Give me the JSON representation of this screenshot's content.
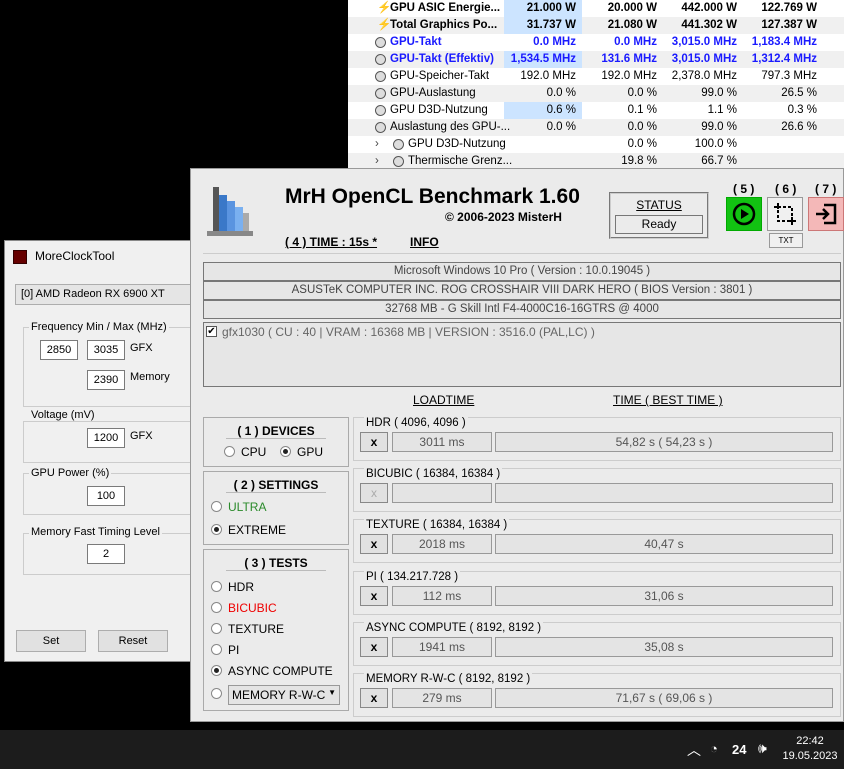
{
  "sensors": [
    {
      "name": "GPU ASIC Energie...",
      "icon": "bolt-icon",
      "style": "b",
      "values": [
        "21.000 W",
        "20.000 W",
        "442.000 W",
        "122.769 W"
      ],
      "hl": true
    },
    {
      "name": "Total Graphics Po...",
      "icon": "bolt-icon",
      "style": "b",
      "values": [
        "31.737 W",
        "21.080 W",
        "441.302 W",
        "127.387 W"
      ],
      "hl": true
    },
    {
      "name": "GPU-Takt",
      "icon": "clock-icon",
      "style": "blue",
      "values": [
        "0.0 MHz",
        "0.0 MHz",
        "3,015.0 MHz",
        "1,183.4 MHz"
      ]
    },
    {
      "name": "GPU-Takt (Effektiv)",
      "icon": "clock-icon",
      "style": "blue",
      "values": [
        "1,534.5 MHz",
        "131.6 MHz",
        "3,015.0 MHz",
        "1,312.4 MHz"
      ],
      "hl": true
    },
    {
      "name": "GPU-Speicher-Takt",
      "icon": "clock-icon",
      "style": "",
      "values": [
        "192.0 MHz",
        "192.0 MHz",
        "2,378.0 MHz",
        "797.3 MHz"
      ]
    },
    {
      "name": "GPU-Auslastung",
      "icon": "clock-icon",
      "style": "",
      "values": [
        "0.0 %",
        "0.0 %",
        "99.0 %",
        "26.5 %"
      ]
    },
    {
      "name": "GPU D3D-Nutzung",
      "icon": "clock-icon",
      "style": "",
      "values": [
        "0.6 %",
        "0.1 %",
        "1.1 %",
        "0.3 %"
      ],
      "hl": true
    },
    {
      "name": "Auslastung des GPU-...",
      "icon": "clock-icon",
      "style": "",
      "values": [
        "0.0 %",
        "0.0 %",
        "99.0 %",
        "26.6 %"
      ]
    },
    {
      "name": "GPU D3D-Nutzung",
      "icon": "clock-icon",
      "style": "",
      "sub": true,
      "values": [
        "",
        "0.0 %",
        "100.0 %",
        ""
      ]
    },
    {
      "name": "Thermische Grenz...",
      "icon": "clock-icon",
      "style": "",
      "sub": true,
      "values": [
        "",
        "19.8 %",
        "66.7 %",
        ""
      ]
    }
  ],
  "moreclock": {
    "title": "MoreClockTool",
    "device": "[0] AMD Radeon RX 6900 XT",
    "freq_label": "Frequency Min / Max (MHz)",
    "freq_min": "2850",
    "freq_max": "3035",
    "gfx": "GFX",
    "memory_value": "2390",
    "memory": "Memory",
    "voltage_label": "Voltage (mV)",
    "voltage": "1200",
    "power_label": "GPU Power (%)",
    "power": "100",
    "mft_label": "Memory Fast Timing Level",
    "mft": "2",
    "set": "Set",
    "reset": "Reset"
  },
  "bench": {
    "title": "MrH OpenCL Benchmark 1.60",
    "copyright": "© 2006-2023 MisterH",
    "time": "( 4 ) TIME : 15s *",
    "info": "INFO",
    "status_label": "STATUS",
    "status": "Ready",
    "b5": "( 5 )",
    "b6": "( 6 )",
    "b7": "( 7 )",
    "txt": "TXT",
    "os": "Microsoft Windows 10 Pro ( Version : 10.0.19045 )",
    "board": "ASUSTeK COMPUTER INC. ROG CROSSHAIR VIII DARK HERO ( BIOS Version : 3801 )",
    "ram": "32768 MB - G Skill Intl F4-4000C16-16GTRS @ 4000",
    "device": "gfx1030 ( CU : 40 | VRAM : 16368 MB | VERSION : 3516.0 (PAL,LC) )",
    "loadtime": "LOADTIME",
    "time_header": "TIME ( BEST TIME )",
    "devices": {
      "title": "( 1 ) DEVICES",
      "cpu": "CPU",
      "gpu": "GPU",
      "selected": "GPU"
    },
    "settings": {
      "title": "( 2 ) SETTINGS",
      "ultra": "ULTRA",
      "extreme": "EXTREME",
      "selected": "EXTREME"
    },
    "tests_title": "( 3 ) TESTS",
    "test_options": [
      "HDR",
      "BICUBIC",
      "TEXTURE",
      "PI",
      "ASYNC COMPUTE",
      "MEMORY R-W-C"
    ],
    "selected_test": "ASYNC COMPUTE",
    "tests": [
      {
        "title": "HDR ( 4096, 4096 )",
        "x": "x",
        "load": "3011 ms",
        "time": "54,82 s ( 54,23 s )"
      },
      {
        "title": "BICUBIC ( 16384, 16384 )",
        "x": "x",
        "load": "",
        "time": "",
        "disabled": true
      },
      {
        "title": "TEXTURE ( 16384, 16384 )",
        "x": "x",
        "load": "2018 ms",
        "time": "40,47 s"
      },
      {
        "title": "PI ( 134.217.728 )",
        "x": "x",
        "load": "112 ms",
        "time": "31,06 s"
      },
      {
        "title": "ASYNC COMPUTE ( 8192, 8192 )",
        "x": "x",
        "load": "1941 ms",
        "time": "35,08 s"
      },
      {
        "title": "MEMORY R-W-C ( 8192, 8192 )",
        "x": "x",
        "load": "279 ms",
        "time": "71,67 s ( 69,06 s )"
      }
    ]
  },
  "taskbar": {
    "battery": "24",
    "time": "22:42",
    "date": "19.05.2023"
  }
}
